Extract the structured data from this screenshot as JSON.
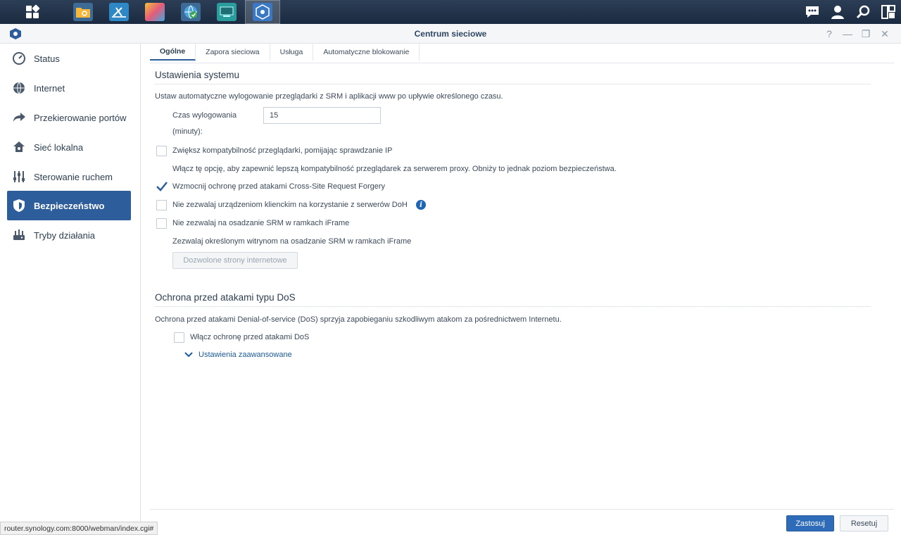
{
  "taskbar": {
    "apps": [
      {
        "icon": "main-menu-icon"
      },
      {
        "icon": "file-station-icon"
      },
      {
        "icon": "network-tools-icon"
      },
      {
        "icon": "photo-icon"
      },
      {
        "icon": "web-globe-icon"
      },
      {
        "icon": "monitor-icon"
      },
      {
        "icon": "network-center-icon"
      }
    ],
    "right_icons": [
      "notifications-icon",
      "user-icon",
      "search-icon",
      "widgets-icon"
    ]
  },
  "window": {
    "title": "Centrum sieciowe",
    "controls": [
      "?",
      "—",
      "❐",
      "✕"
    ]
  },
  "sidebar": {
    "items": [
      {
        "label": "Status",
        "icon": "status-icon"
      },
      {
        "label": "Internet",
        "icon": "internet-icon"
      },
      {
        "label": "Przekierowanie portów",
        "icon": "port-forwarding-icon"
      },
      {
        "label": "Sieć lokalna",
        "icon": "local-network-icon"
      },
      {
        "label": "Sterowanie ruchem",
        "icon": "traffic-control-icon"
      },
      {
        "label": "Bezpieczeństwo",
        "icon": "security-shield-icon",
        "active": true
      },
      {
        "label": "Tryby działania",
        "icon": "operation-modes-icon"
      }
    ]
  },
  "tabs": [
    {
      "label": "Ogólne",
      "active": true
    },
    {
      "label": "Zapora sieciowa"
    },
    {
      "label": "Usługa"
    },
    {
      "label": "Automatyczne blokowanie"
    }
  ],
  "system_settings": {
    "title": "Ustawienia systemu",
    "description": "Ustaw automatyczne wylogowanie przeglądarki z SRM i aplikacji www po upływie określonego czasu.",
    "logout_label_1": "Czas wylogowania",
    "logout_label_2": "(minuty):",
    "logout_value": "15",
    "option_ip_check": {
      "label": "Zwiększ kompatybilność przeglądarki, pomijając sprawdzanie IP",
      "checked": false
    },
    "option_ip_check_note": "Włącz tę opcję, aby zapewnić lepszą kompatybilność przeglądarek za serwerem proxy. Obniży to jednak poziom bezpieczeństwa.",
    "option_csrf": {
      "label": "Wzmocnij ochronę przed atakami Cross-Site Request Forgery",
      "checked": true
    },
    "option_doh": {
      "label": "Nie zezwalaj urządzeniom klienckim na korzystanie z serwerów DoH",
      "checked": false
    },
    "info_glyph": "i",
    "option_iframe": {
      "label": "Nie zezwalaj na osadzanie SRM w ramkach iFrame",
      "checked": false
    },
    "iframe_note": "Zezwalaj określonym witrynom na osadzanie SRM w ramkach iFrame",
    "allowed_sites_button": "Dozwolone strony internetowe"
  },
  "dos": {
    "title": "Ochrona przed atakami typu DoS",
    "description": "Ochrona przed atakami Denial-of-service (DoS) sprzyja zapobieganiu szkodliwym atakom za pośrednictwem Internetu.",
    "option_enable": {
      "label": "Włącz ochronę przed atakami DoS",
      "checked": false
    },
    "advanced_link": "Ustawienia zaawansowane"
  },
  "footer": {
    "apply_label": "Zastosuj",
    "reset_label": "Resetuj"
  },
  "status_bar": "router.synology.com:8000/webman/index.cgi#",
  "colors": {
    "accent": "#2d5d9b",
    "primary_button": "#2e6bb8",
    "link": "#1c5a9c",
    "taskbar": "#1f3048"
  }
}
